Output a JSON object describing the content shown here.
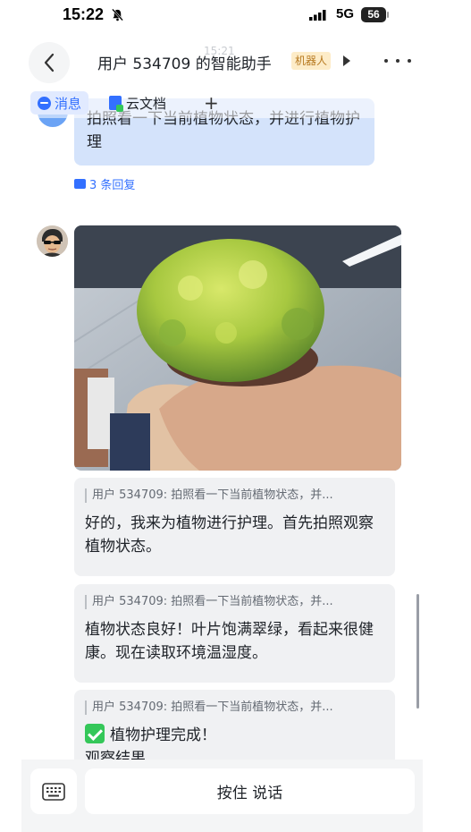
{
  "status_bar": {
    "time": "15:22",
    "network": "5G",
    "battery": "56"
  },
  "header": {
    "ghost_time": "15:21",
    "title": "用户 534709 的智能助手",
    "tag": "机器人"
  },
  "tabs": [
    {
      "label": "消息",
      "active": true
    },
    {
      "label": "云文档",
      "active": false
    },
    {
      "label": "+",
      "active": false
    }
  ],
  "user_message": {
    "text": "拍照看一下当前植物状态，并进行植物护理",
    "reply_link": "3 条回复"
  },
  "bot_cards": [
    {
      "quote": "用户 534709: 拍照看一下当前植物状态，并...",
      "text": "好的，我来为植物进行护理。首先拍照观察植物状态。"
    },
    {
      "quote": "用户 534709: 拍照看一下当前植物状态，并...",
      "text": "植物状态良好！叶片饱满翠绿，看起来很健康。现在读取环境温湿度。"
    },
    {
      "quote": "用户 534709: 拍照看一下当前植物状态，并...",
      "text": "植物护理完成！",
      "text2": "观察结果"
    }
  ],
  "input": {
    "talk_label": "按住 说话"
  },
  "colors": {
    "accent": "#3370ff",
    "bubble": "#d4e3fb",
    "card": "#f0f1f3"
  }
}
